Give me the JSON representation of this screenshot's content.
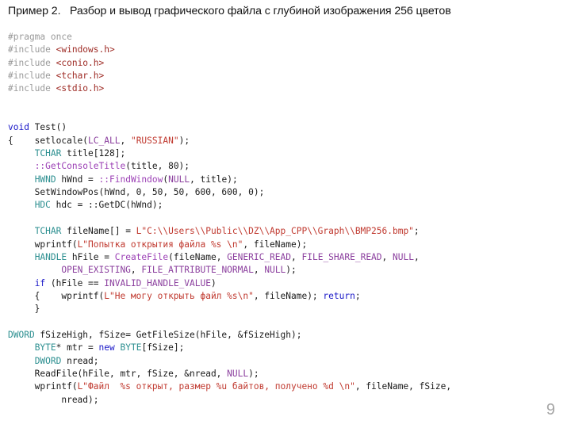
{
  "slide": {
    "title": "Пример 2.   Разбор и вывод графического файла с глубиной изображения 256 цветов",
    "page_number": "9",
    "background_color": "#ffffff",
    "title_color": "#141414",
    "page_number_color": "#a6a6a6"
  },
  "syntax_colors": {
    "preprocessor": "#9a9a9a",
    "header": "#9e2b25",
    "keyword": "#1a18c8",
    "type": "#2c8f90",
    "function": "#9b3fb5",
    "constant": "#8b3f9e",
    "string": "#c0392f",
    "plain": "#1a1a1a"
  },
  "code": {
    "language": "cpp",
    "lines": [
      {
        "id": "l01",
        "tokens": [
          {
            "t": "#pragma once",
            "c": "pre"
          }
        ]
      },
      {
        "id": "l02",
        "tokens": [
          {
            "t": "#include ",
            "c": "pre"
          },
          {
            "t": "<windows.h>",
            "c": "hdr"
          }
        ]
      },
      {
        "id": "l03",
        "tokens": [
          {
            "t": "#include ",
            "c": "pre"
          },
          {
            "t": "<conio.h>",
            "c": "hdr"
          }
        ]
      },
      {
        "id": "l04",
        "tokens": [
          {
            "t": "#include ",
            "c": "pre"
          },
          {
            "t": "<tchar.h>",
            "c": "hdr"
          }
        ]
      },
      {
        "id": "l05",
        "tokens": [
          {
            "t": "#include ",
            "c": "pre"
          },
          {
            "t": "<stdio.h>",
            "c": "hdr"
          }
        ]
      },
      {
        "id": "l06",
        "tokens": []
      },
      {
        "id": "l07",
        "tokens": []
      },
      {
        "id": "l08",
        "tokens": [
          {
            "t": "void",
            "c": "kw"
          },
          {
            "t": " Test()",
            "c": "plain"
          }
        ]
      },
      {
        "id": "l09",
        "tokens": [
          {
            "t": "{    setlocale(",
            "c": "plain"
          },
          {
            "t": "LC_ALL",
            "c": "const"
          },
          {
            "t": ", ",
            "c": "plain"
          },
          {
            "t": "\"RUSSIAN\"",
            "c": "str"
          },
          {
            "t": ");",
            "c": "plain"
          }
        ]
      },
      {
        "id": "l10",
        "tokens": [
          {
            "t": "     ",
            "c": "plain"
          },
          {
            "t": "TCHAR",
            "c": "type"
          },
          {
            "t": " title[128];",
            "c": "plain"
          }
        ]
      },
      {
        "id": "l11",
        "tokens": [
          {
            "t": "     ",
            "c": "plain"
          },
          {
            "t": "::GetConsoleTitle",
            "c": "fn"
          },
          {
            "t": "(title, 80);",
            "c": "plain"
          }
        ]
      },
      {
        "id": "l12",
        "tokens": [
          {
            "t": "     ",
            "c": "plain"
          },
          {
            "t": "HWND",
            "c": "type"
          },
          {
            "t": " hWnd = ",
            "c": "plain"
          },
          {
            "t": "::FindWindow",
            "c": "fn"
          },
          {
            "t": "(",
            "c": "plain"
          },
          {
            "t": "NULL",
            "c": "const"
          },
          {
            "t": ", title);",
            "c": "plain"
          }
        ]
      },
      {
        "id": "l13",
        "tokens": [
          {
            "t": "     SetWindowPos(hWnd, 0, 50, 50, 600, 600, 0);",
            "c": "plain"
          }
        ]
      },
      {
        "id": "l14",
        "tokens": [
          {
            "t": "     ",
            "c": "plain"
          },
          {
            "t": "HDC",
            "c": "type"
          },
          {
            "t": " hdc = ::GetDC(hWnd);",
            "c": "plain"
          }
        ]
      },
      {
        "id": "l15",
        "tokens": []
      },
      {
        "id": "l16",
        "tokens": [
          {
            "t": "     ",
            "c": "plain"
          },
          {
            "t": "TCHAR",
            "c": "type"
          },
          {
            "t": " fileName[] = ",
            "c": "plain"
          },
          {
            "t": "L\"C:\\\\Users\\\\Public\\\\DZ\\\\App_CPP\\\\Graph\\\\BMP256.bmp\"",
            "c": "str"
          },
          {
            "t": ";",
            "c": "plain"
          }
        ]
      },
      {
        "id": "l17",
        "tokens": [
          {
            "t": "     wprintf(",
            "c": "plain"
          },
          {
            "t": "L\"Попытка открытия файла %s \\n\"",
            "c": "str"
          },
          {
            "t": ", fileName);",
            "c": "plain"
          }
        ]
      },
      {
        "id": "l18",
        "tokens": [
          {
            "t": "     ",
            "c": "plain"
          },
          {
            "t": "HANDLE",
            "c": "type"
          },
          {
            "t": " hFile = ",
            "c": "plain"
          },
          {
            "t": "CreateFile",
            "c": "fn"
          },
          {
            "t": "(fileName, ",
            "c": "plain"
          },
          {
            "t": "GENERIC_READ",
            "c": "const"
          },
          {
            "t": ", ",
            "c": "plain"
          },
          {
            "t": "FILE_SHARE_READ",
            "c": "const"
          },
          {
            "t": ", ",
            "c": "plain"
          },
          {
            "t": "NULL",
            "c": "const"
          },
          {
            "t": ",",
            "c": "plain"
          }
        ]
      },
      {
        "id": "l19",
        "tokens": [
          {
            "t": "          ",
            "c": "plain"
          },
          {
            "t": "OPEN_EXISTING",
            "c": "const"
          },
          {
            "t": ", ",
            "c": "plain"
          },
          {
            "t": "FILE_ATTRIBUTE_NORMAL",
            "c": "const"
          },
          {
            "t": ", ",
            "c": "plain"
          },
          {
            "t": "NULL",
            "c": "const"
          },
          {
            "t": ");",
            "c": "plain"
          }
        ]
      },
      {
        "id": "l20",
        "tokens": [
          {
            "t": "     ",
            "c": "plain"
          },
          {
            "t": "if",
            "c": "kw"
          },
          {
            "t": " (hFile == ",
            "c": "plain"
          },
          {
            "t": "INVALID_HANDLE_VALUE",
            "c": "const"
          },
          {
            "t": ")",
            "c": "plain"
          }
        ]
      },
      {
        "id": "l21",
        "tokens": [
          {
            "t": "     {    wprintf(",
            "c": "plain"
          },
          {
            "t": "L\"Не могу открыть файл %s\\n\"",
            "c": "str"
          },
          {
            "t": ", fileName); ",
            "c": "plain"
          },
          {
            "t": "return",
            "c": "kw"
          },
          {
            "t": ";",
            "c": "plain"
          }
        ]
      },
      {
        "id": "l22",
        "tokens": [
          {
            "t": "     }",
            "c": "plain"
          }
        ]
      },
      {
        "id": "l23",
        "tokens": []
      },
      {
        "id": "l24",
        "tokens": [
          {
            "t": "DWORD",
            "c": "type"
          },
          {
            "t": " fSizeHigh, fSize= GetFileSize(hFile, &fSizeHigh);",
            "c": "plain"
          }
        ]
      },
      {
        "id": "l25",
        "tokens": [
          {
            "t": "     ",
            "c": "plain"
          },
          {
            "t": "BYTE",
            "c": "type"
          },
          {
            "t": "* mtr = ",
            "c": "plain"
          },
          {
            "t": "new",
            "c": "kw"
          },
          {
            "t": " ",
            "c": "plain"
          },
          {
            "t": "BYTE",
            "c": "type"
          },
          {
            "t": "[fSize];",
            "c": "plain"
          }
        ]
      },
      {
        "id": "l26",
        "tokens": [
          {
            "t": "     ",
            "c": "plain"
          },
          {
            "t": "DWORD",
            "c": "type"
          },
          {
            "t": " nread;",
            "c": "plain"
          }
        ]
      },
      {
        "id": "l27",
        "tokens": [
          {
            "t": "     ReadFile(hFile, mtr, fSize, &nread, ",
            "c": "plain"
          },
          {
            "t": "NULL",
            "c": "const"
          },
          {
            "t": ");",
            "c": "plain"
          }
        ]
      },
      {
        "id": "l28",
        "tokens": [
          {
            "t": "     wprintf(",
            "c": "plain"
          },
          {
            "t": "L\"Файл  %s открыт, размер %u байтов, получено %d \\n\"",
            "c": "str"
          },
          {
            "t": ", fileName, fSize,",
            "c": "plain"
          }
        ]
      },
      {
        "id": "l29",
        "tokens": [
          {
            "t": "          nread);",
            "c": "plain"
          }
        ]
      }
    ]
  }
}
